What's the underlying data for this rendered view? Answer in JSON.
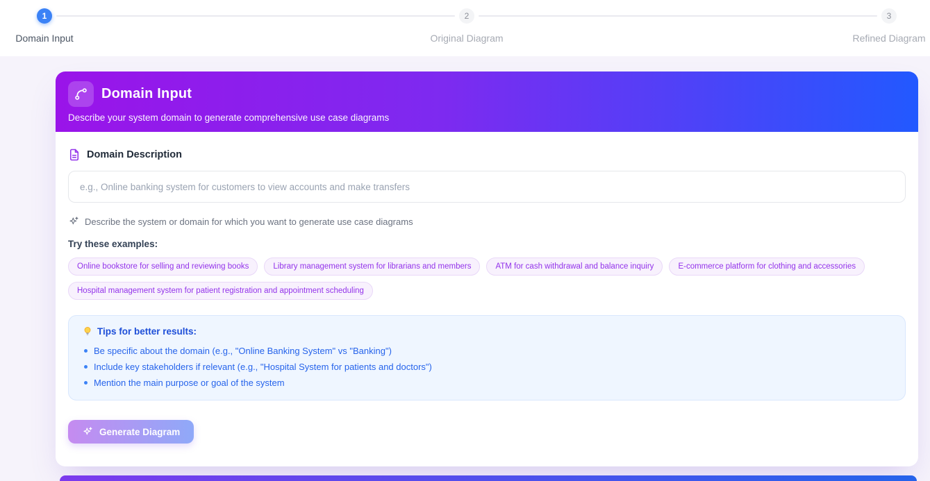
{
  "page": {
    "background": "#f6f3fb",
    "accent_purple": "#9333ea",
    "accent_blue": "#2563eb",
    "active_step_color": "#3b82f6"
  },
  "stepper": {
    "steps": [
      {
        "number": "1",
        "label": "Domain Input",
        "state": "active"
      },
      {
        "number": "2",
        "label": "Original Diagram",
        "state": "upcoming"
      },
      {
        "number": "3",
        "label": "Refined Diagram",
        "state": "upcoming"
      }
    ]
  },
  "card": {
    "header": {
      "icon": "bezier-curve-icon",
      "title": "Domain Input",
      "subtitle": "Describe your system domain to generate comprehensive use case diagrams",
      "gradient_from": "#9a14e9",
      "gradient_to": "#2259ff"
    },
    "form": {
      "label": "Domain Description",
      "label_icon": "file-text-icon",
      "input_value": "",
      "input_placeholder": "e.g., Online banking system for customers to view accounts and make transfers",
      "helper_icon": "sparkles-icon",
      "helper_text": "Describe the system or domain for which you want to generate use case diagrams"
    },
    "examples": {
      "heading": "Try these examples:",
      "chips": [
        "Online bookstore for selling and reviewing books",
        "Library management system for librarians and members",
        "ATM for cash withdrawal and balance inquiry",
        "E-commerce platform for clothing and accessories",
        "Hospital management system for patient registration and appointment scheduling"
      ]
    },
    "tips": {
      "icon": "lightbulb-icon",
      "heading": "Tips for better results:",
      "items": [
        "Be specific about the domain (e.g., \"Online Banking System\" vs \"Banking\")",
        "Include key stakeholders if relevant (e.g., \"Hospital System for patients and doctors\")",
        "Mention the main purpose or goal of the system"
      ]
    },
    "generate": {
      "label": "Generate Diagram",
      "icon": "sparkles-icon",
      "enabled": false
    }
  }
}
